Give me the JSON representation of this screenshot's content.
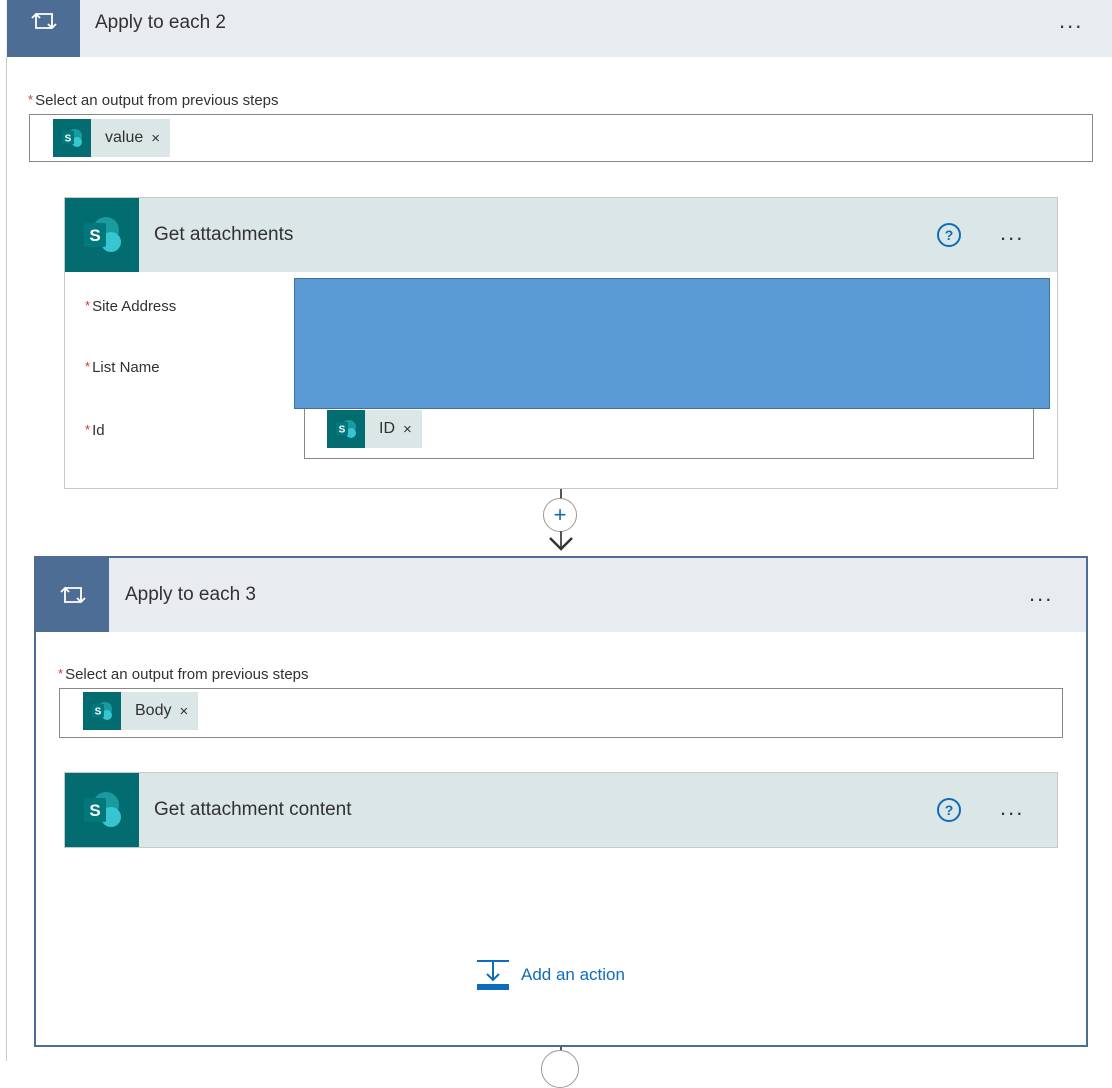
{
  "outer_loop": {
    "title": "Apply to each 2",
    "more": "...",
    "field_label": "Select an output from previous steps",
    "required_mark": "*",
    "token": "value",
    "token_remove": "×"
  },
  "get_attachments": {
    "title": "Get attachments",
    "help": "?",
    "more": "...",
    "fields": [
      {
        "label": "Site Address",
        "required": "*"
      },
      {
        "label": "List Name",
        "required": "*"
      },
      {
        "label": "Id",
        "required": "*"
      }
    ],
    "id_token": "ID",
    "id_token_remove": "×"
  },
  "connector": {
    "plus": "+"
  },
  "inner_loop": {
    "title": "Apply to each 3",
    "more": "...",
    "field_label": "Select an output from previous steps",
    "required_mark": "*",
    "token": "Body",
    "token_remove": "×"
  },
  "get_attachment_content": {
    "title": "Get attachment content",
    "help": "?",
    "more": "..."
  },
  "add_action": {
    "label": "Add an action"
  },
  "icons": {
    "loop": "loop-icon",
    "sharepoint": "sharepoint-icon",
    "help": "help-icon",
    "add_action": "add-action-icon"
  },
  "colors": {
    "loop_tile": "#4e6d94",
    "sharepoint": "#036c70",
    "card_header": "#dbe7e7",
    "loop_header": "#e8ebf0",
    "link": "#0f6cbd",
    "required": "#d13438"
  }
}
